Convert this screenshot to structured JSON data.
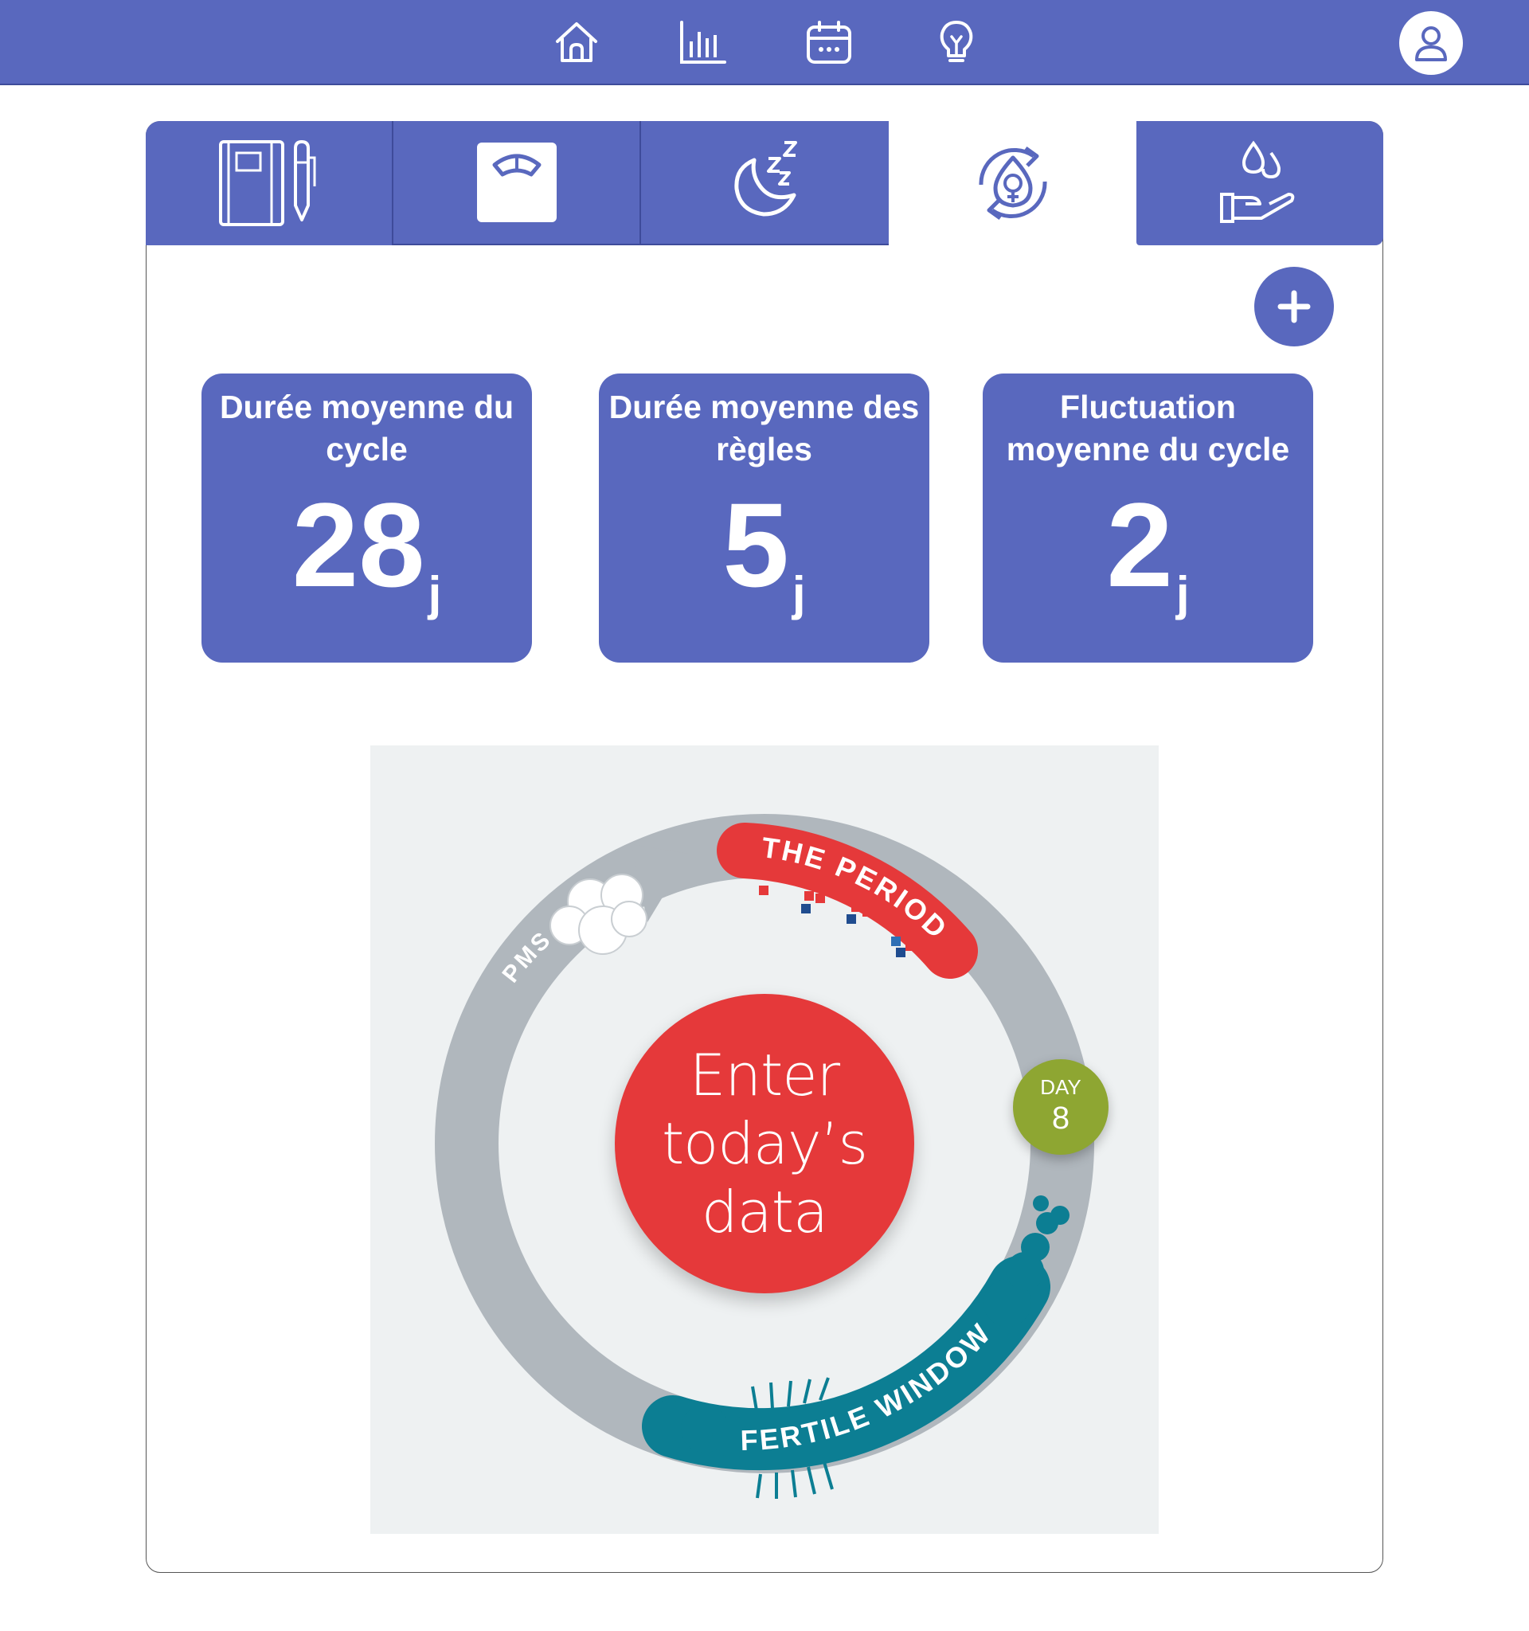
{
  "nav": {
    "items": [
      {
        "name": "home",
        "icon": "home-icon"
      },
      {
        "name": "stats",
        "icon": "bar-chart-icon"
      },
      {
        "name": "calendar",
        "icon": "calendar-icon"
      },
      {
        "name": "tips",
        "icon": "lightbulb-icon"
      }
    ],
    "profile_icon": "user-icon"
  },
  "tabs": [
    {
      "name": "journal",
      "icon": "notebook-pen-icon",
      "active": false
    },
    {
      "name": "weight",
      "icon": "scale-icon",
      "active": false
    },
    {
      "name": "sleep",
      "icon": "moon-zzz-icon",
      "active": false
    },
    {
      "name": "cycle",
      "icon": "cycle-female-icon",
      "active": true
    },
    {
      "name": "care",
      "icon": "hand-drops-icon",
      "active": false
    }
  ],
  "add_button": {
    "icon": "plus-icon",
    "label": "+"
  },
  "stats": [
    {
      "title": "Durée moyenne du cycle",
      "value": "28",
      "unit": "j"
    },
    {
      "title": "Durée moyenne des règles",
      "value": "5",
      "unit": "j"
    },
    {
      "title": "Fluctuation moyenne du cycle",
      "value": "2",
      "unit": "j"
    }
  ],
  "cycle_wheel": {
    "period_label": "THE PERIOD",
    "pms_label": "PMS",
    "fertile_label": "FERTILE WINDOW",
    "center": {
      "line1": "Enter",
      "line2": "today’s",
      "line3": "data"
    },
    "day_label": "DAY",
    "day_number": "8"
  },
  "colors": {
    "primary": "#5968BE",
    "period_red": "#E5393A",
    "fertile_teal": "#0C7E93",
    "day_green": "#8EA632",
    "ring_gray": "#B0B7BD"
  }
}
